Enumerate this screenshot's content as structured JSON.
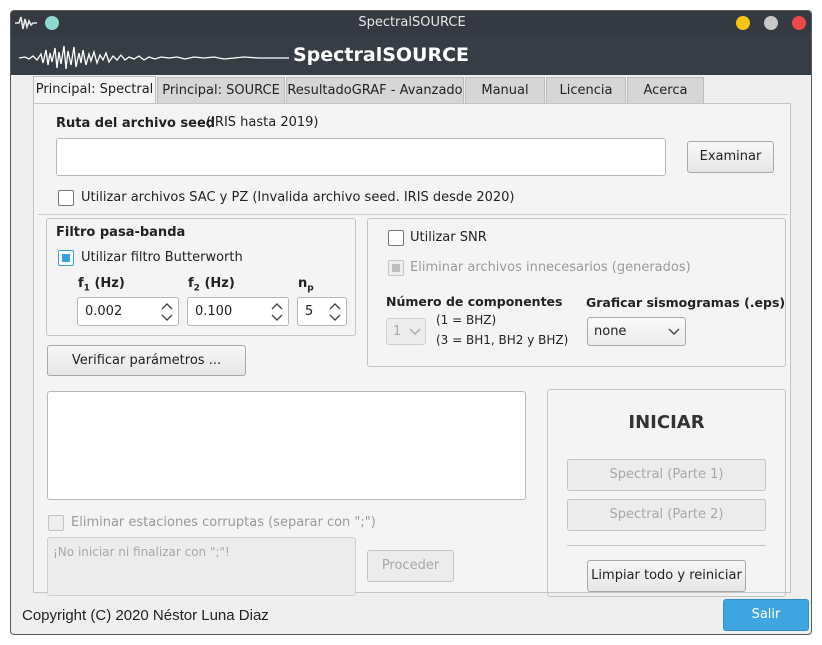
{
  "window": {
    "title": "SpectralSOURCE"
  },
  "banner": {
    "title": "SpectralSOURCE"
  },
  "tabs": [
    {
      "label": "Principal: Spectral"
    },
    {
      "label": "Principal: SOURCE"
    },
    {
      "label": "ResultadoGRAF - Avanzado"
    },
    {
      "label": "Manual"
    },
    {
      "label": "Licencia"
    },
    {
      "label": "Acerca"
    }
  ],
  "seed": {
    "label": "Ruta del archivo seed",
    "note": "(IRIS hasta 2019)",
    "value": "",
    "browse": "Examinar",
    "sacpz_label": "Utilizar archivos SAC y PZ (Invalida archivo seed. IRIS desde 2020)"
  },
  "filter": {
    "title": "Filtro pasa-banda",
    "butterworth_label": "Utilizar filtro Butterworth",
    "f1_label": "f",
    "f1_sub": "1",
    "f1_unit": " (Hz)",
    "f2_label": "f",
    "f2_sub": "2",
    "f2_unit": " (Hz)",
    "np_label": "n",
    "np_sub": "p",
    "f1_value": "0.002",
    "f2_value": "0.100",
    "np_value": "5"
  },
  "snr": {
    "use_label": "Utilizar SNR",
    "delete_label": "Eliminar archivos innecesarios (generados)",
    "components_label": "Número de componentes",
    "components_value": "1",
    "components_note1": "(1 = BHZ)",
    "components_note2": "(3 = BH1, BH2 y BHZ)",
    "plot_label": "Graficar sismogramas (.eps)",
    "plot_value": "none"
  },
  "verify_button": "Verificar parámetros ...",
  "corrupt": {
    "label": "Eliminar estaciones corruptas (separar con \";\")",
    "placeholder": "¡No iniciar ni finalizar con \";\"!",
    "proceed": "Proceder"
  },
  "start": {
    "title": "INICIAR",
    "part1": "Spectral (Parte 1)",
    "part2": "Spectral (Parte 2)",
    "reset": "Limpiar todo y reiniciar"
  },
  "footer": {
    "copyright": "Copyright (C) 2020 Néstor Luna Diaz",
    "exit": "Salir"
  },
  "colors": {
    "accent": "#3aa0d8",
    "exit_button": "#3fa5e0",
    "titlebar": "#343a40",
    "dot_yellow": "#f5c518",
    "dot_gray": "#c8c8c8",
    "dot_red": "#e84a4a",
    "dot_teal": "#8ed9d0"
  }
}
